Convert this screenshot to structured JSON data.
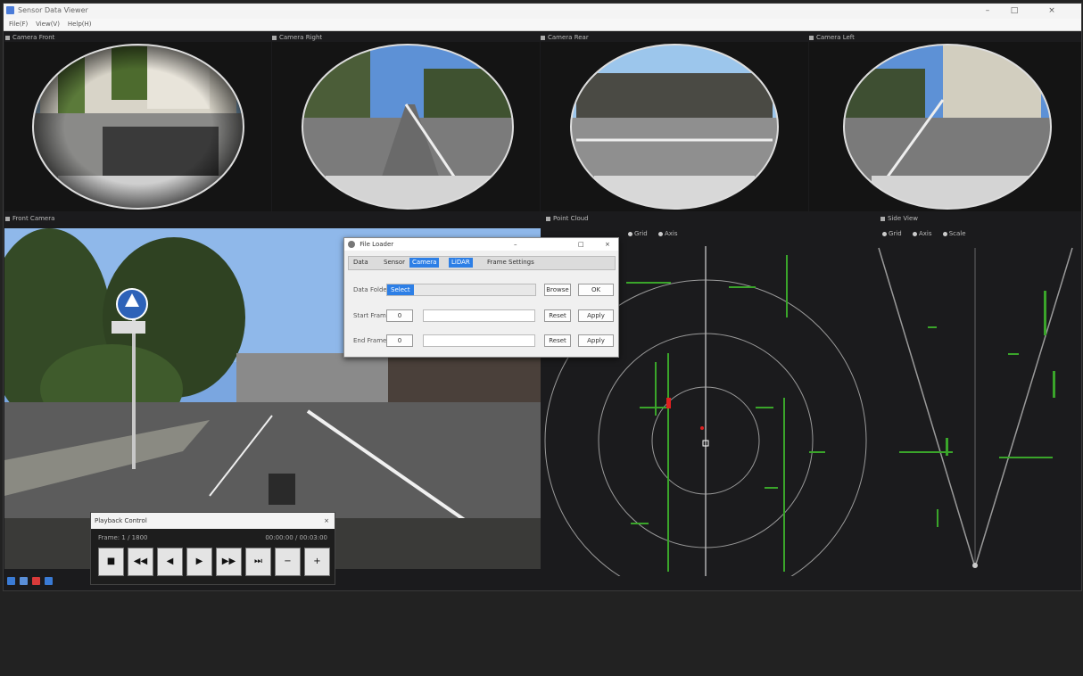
{
  "window": {
    "title": "Sensor Data Viewer",
    "menu": [
      "File(F)",
      "View(V)",
      "Help(H)"
    ],
    "controls": {
      "minimize": "–",
      "maximize": "□",
      "close": "×"
    }
  },
  "panels": {
    "fisheye_1": "Camera Front",
    "fisheye_2": "Camera Right",
    "fisheye_3": "Camera Rear",
    "fisheye_4": "Camera Left",
    "front_camera": "Front Camera",
    "lidar_top": "Point Cloud",
    "lidar_side": "Side View"
  },
  "lidar_top_options": [
    "Grid",
    "Axis"
  ],
  "lidar_side_options": [
    "Grid",
    "Axis",
    "Scale"
  ],
  "dialog": {
    "title": "File Loader",
    "tabs": [
      "Data",
      "Sensor",
      "Camera",
      "LiDAR",
      "Frame Settings"
    ],
    "active_tab_indices": [
      2,
      3
    ],
    "rows": [
      {
        "label": "Data Folder",
        "value": "Select",
        "buttons": [
          "Browse",
          "OK"
        ]
      },
      {
        "label": "Start Frame",
        "value": "0",
        "buttons": [
          "Reset",
          "Apply"
        ]
      },
      {
        "label": "End Frame",
        "value": "0",
        "buttons": [
          "Reset",
          "Apply"
        ]
      }
    ]
  },
  "player": {
    "title": "Playback Control",
    "frame_info": "Frame: 1 / 1800",
    "time_info": "00:00:00 / 00:03:00",
    "buttons": [
      "■",
      "◀◀",
      "◀",
      "▶",
      "▶▶",
      "⏭",
      "−",
      "+"
    ]
  },
  "colors": {
    "accent": "#2d7fe6",
    "point_green": "#3aa52a",
    "point_red": "#e02020",
    "grid": "#9a9a9a"
  },
  "status_icons": [
    "grid-view-icon",
    "camera-icon",
    "record-icon",
    "info-icon"
  ]
}
